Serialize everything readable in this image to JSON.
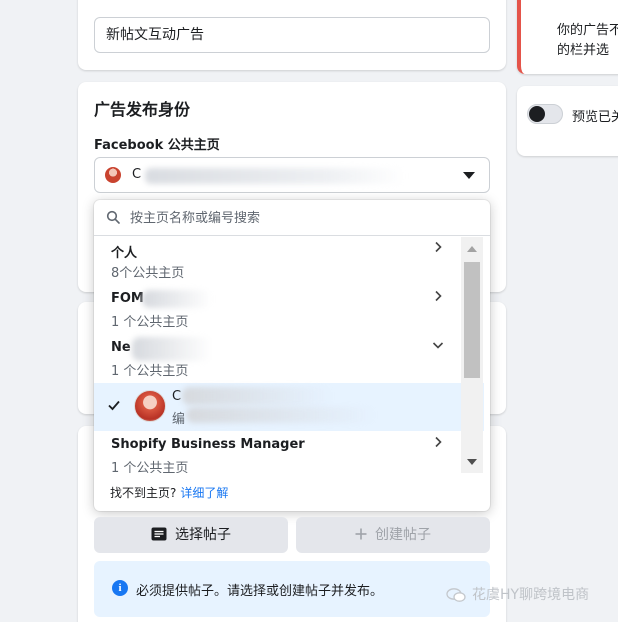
{
  "ad_name": {
    "value": "新帖文互动广告"
  },
  "identity": {
    "title": "广告发布身份",
    "facebook_label": "Facebook 公共主页",
    "selected_visible_char": "C"
  },
  "dropdown": {
    "search_placeholder": "按主页名称或编号搜索",
    "items": [
      {
        "title": "个人",
        "subtitle": "8个公共主页",
        "chevron": "chevron-right-icon"
      },
      {
        "title": "FOM",
        "subtitle": "1 个公共主页",
        "chevron": "chevron-right-icon"
      },
      {
        "title": "Ne",
        "subtitle": "1 个公共主页",
        "chevron": "chevron-down-icon"
      },
      {
        "title": "C",
        "subtitle": "编",
        "selected": true
      },
      {
        "title": "Shopify Business Manager",
        "subtitle": "1 个公共主页",
        "chevron": "chevron-right-icon"
      }
    ],
    "footer_text": "找不到主页?",
    "footer_link": "详细了解"
  },
  "post": {
    "select_button": "选择帖子",
    "create_button": "创建帖子",
    "info_text": "必须提供帖子。请选择或创建帖子并发布。"
  },
  "right_panel": {
    "warning_line1": "你的广告不",
    "warning_line2": "的栏并选",
    "preview_label": "预览已关"
  },
  "watermark": "花虞HY聊跨境电商",
  "colors": {
    "accent": "#1877f2",
    "warning_border": "#e4544a",
    "selected_row": "#e7f3ff"
  }
}
